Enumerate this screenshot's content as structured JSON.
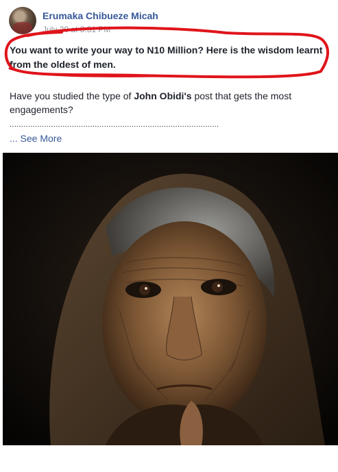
{
  "post": {
    "author": "Erumaka Chibueze Micah",
    "timestamp": "July 20 at 8:51 PM",
    "headline": "You want to write your way to N10 Million? Here is the wisdom learnt from the oldest of men.",
    "body_prefix": "Have you studied the type of ",
    "body_bold": "John Obidi's",
    "body_suffix": " post that gets the most engagements?",
    "dots": "...........................................................................................",
    "see_more": "... See More"
  },
  "annotation_color": "#e0141b"
}
